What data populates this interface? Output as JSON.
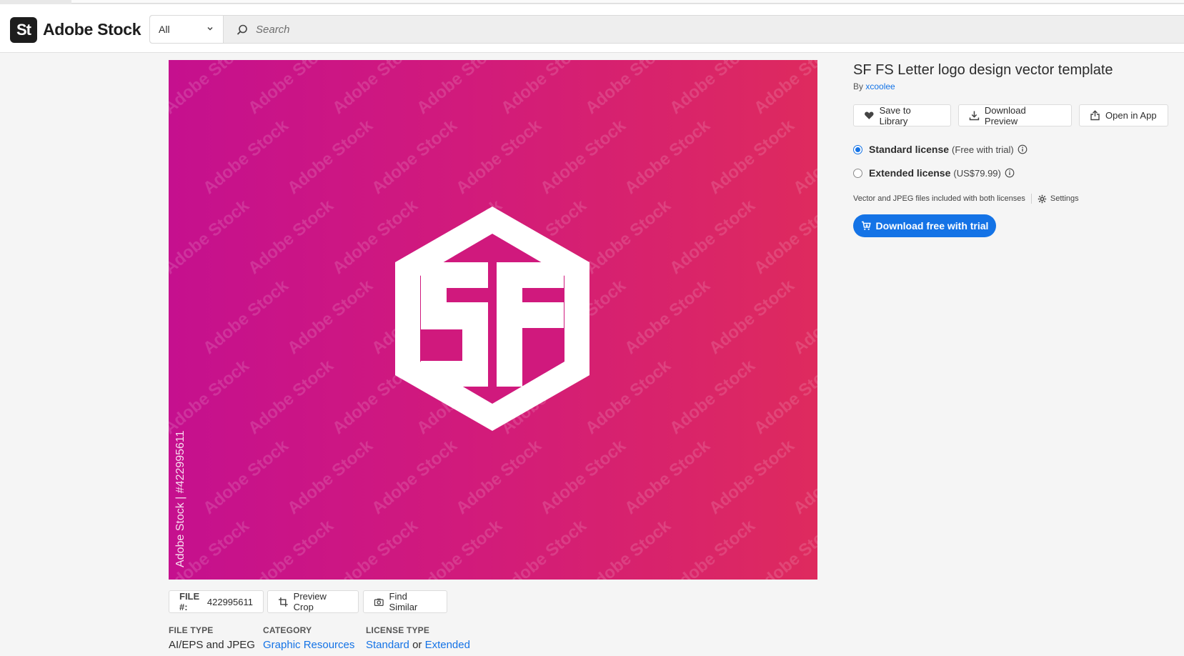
{
  "brand": {
    "badge": "St",
    "name": "Adobe Stock"
  },
  "search": {
    "scope_value": "All",
    "placeholder": "Search"
  },
  "preview": {
    "watermark_text": "Adobe Stock",
    "vertical_id": "Adobe Stock | #422995611",
    "logo_letters": "SF"
  },
  "asset": {
    "title": "SF FS Letter logo design vector template",
    "by_prefix": "By",
    "author": "xcoolee"
  },
  "actions": {
    "save": "Save to Library",
    "download_preview": "Download Preview",
    "open_in_app": "Open in App"
  },
  "licenses": {
    "standard": {
      "name": "Standard license",
      "note": "(Free with trial)",
      "selected": true
    },
    "extended": {
      "name": "Extended license",
      "note": "(US$79.99)",
      "selected": false
    },
    "included_text": "Vector and JPEG files included with both licenses",
    "settings_label": "Settings"
  },
  "cta": {
    "label": "Download free with trial"
  },
  "file": {
    "label": "FILE #:",
    "number": "422995611",
    "preview_crop": "Preview Crop",
    "find_similar": "Find Similar"
  },
  "facts": {
    "file_type": {
      "heading": "FILE TYPE",
      "value": "AI/EPS and JPEG"
    },
    "category": {
      "heading": "CATEGORY",
      "value": "Graphic Resources"
    },
    "license_type": {
      "heading": "LICENSE TYPE",
      "standard": "Standard",
      "or": "or",
      "extended": "Extended"
    }
  },
  "colors": {
    "accent": "#1473e6",
    "gradient_start": "#c5108e",
    "gradient_end": "#de2a5e"
  }
}
